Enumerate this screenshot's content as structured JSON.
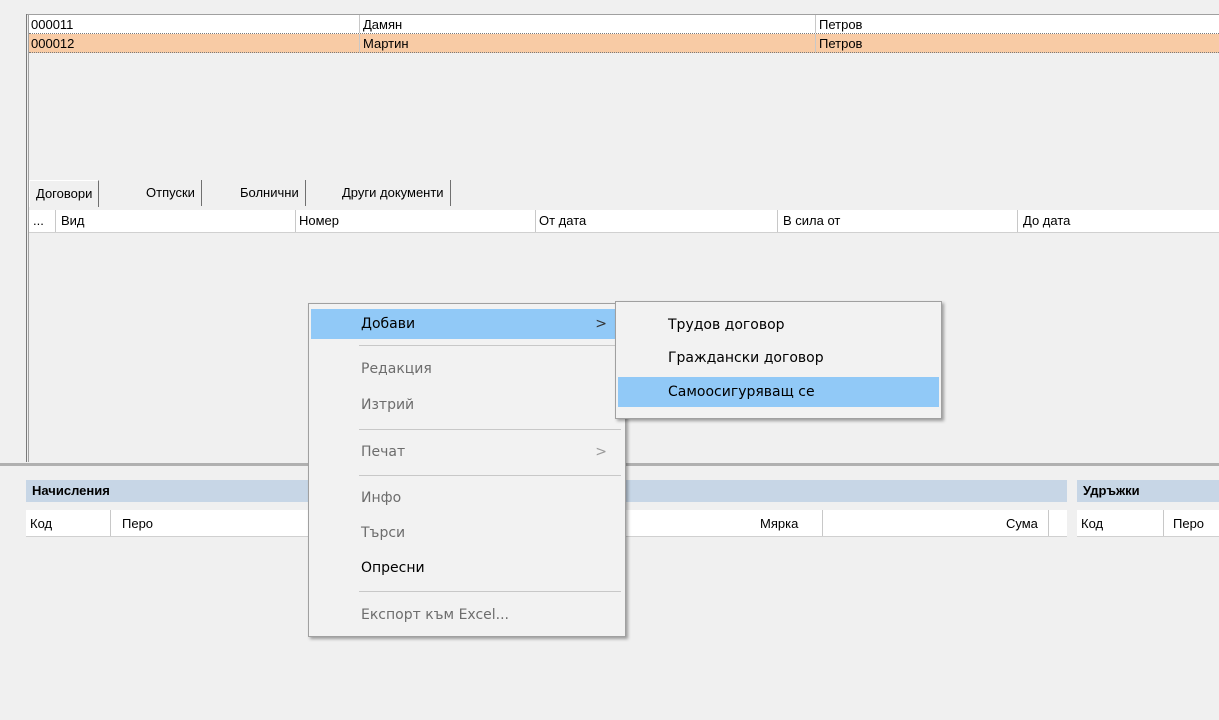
{
  "employees": [
    {
      "code": "000011",
      "first_name": "Дамян",
      "last_name": "Петров"
    },
    {
      "code": "000012",
      "first_name": "Мартин",
      "last_name": "Петров"
    }
  ],
  "tabs": [
    "Договори",
    "Отпуски",
    "Болнични",
    "Други документи"
  ],
  "contracts_columns": [
    "...",
    "Вид",
    "Номер",
    "От дата",
    "В сила от",
    "До дата"
  ],
  "accruals": {
    "title": "Начисления",
    "columns": [
      "Код",
      "Перо",
      "Мярка",
      "Сума"
    ]
  },
  "deductions": {
    "title": "Удръжки",
    "columns": [
      "Код",
      "Перо"
    ]
  },
  "context_menu": {
    "items": [
      {
        "label": "Добави",
        "arrow": ">"
      },
      {
        "label": "Редакция"
      },
      {
        "label": "Изтрий"
      },
      {
        "label": "Печат",
        "arrow": ">"
      },
      {
        "label": "Инфо"
      },
      {
        "label": "Търси"
      },
      {
        "label": "Опресни"
      },
      {
        "label": "Експорт към Excel..."
      }
    ]
  },
  "submenu": {
    "items": [
      "Трудов договор",
      "Граждански договор",
      "Самоосигуряващ се"
    ]
  },
  "colors": {
    "selected_row": "#f8cba5",
    "menu_highlight": "#91c9f7",
    "panel_title": "#c7d6e6"
  }
}
